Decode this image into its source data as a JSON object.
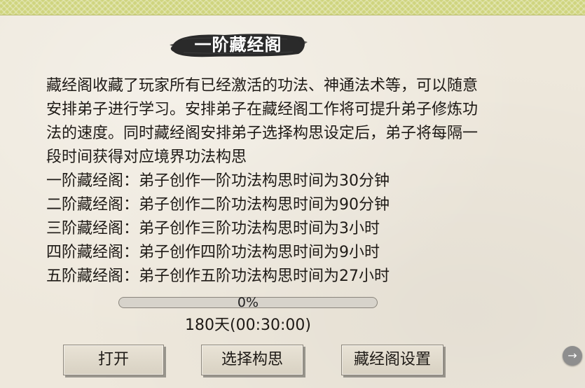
{
  "header": {
    "title": "一阶藏经阁"
  },
  "description_lines": [
    "藏经阁收藏了玩家所有已经激活的功法、神通法术等，可以随意",
    "安排弟子进行学习。安排弟子在藏经阁工作将可提升弟子修炼功",
    "法的速度。同时藏经阁安排弟子选择构思设定后，弟子将每隔一",
    "段时间获得对应境界功法构思"
  ],
  "tiers": [
    "一阶藏经阁：弟子创作一阶功法构思时间为30分钟",
    "二阶藏经阁：弟子创作二阶功法构思时间为90分钟",
    "三阶藏经阁：弟子创作三阶功法构思时间为3小时",
    "四阶藏经阁：弟子创作四阶功法构思时间为9小时",
    "五阶藏经阁：弟子创作五阶功法构思时间为27小时"
  ],
  "progress": {
    "value": 0,
    "label": "0%"
  },
  "timer": {
    "text": "180天(00:30:00)"
  },
  "buttons": {
    "open": "打开",
    "select": "选择构思",
    "settings": "藏经阁设置"
  },
  "side_button": {
    "icon": "arrow-right-icon",
    "glyph": "→"
  },
  "colors": {
    "top_border": "#cfd47e",
    "panel_bg": "#eee8dc",
    "title_brush": "#2a2a2a",
    "title_text": "#ffffff",
    "progress_fill": "#8fb06a"
  }
}
